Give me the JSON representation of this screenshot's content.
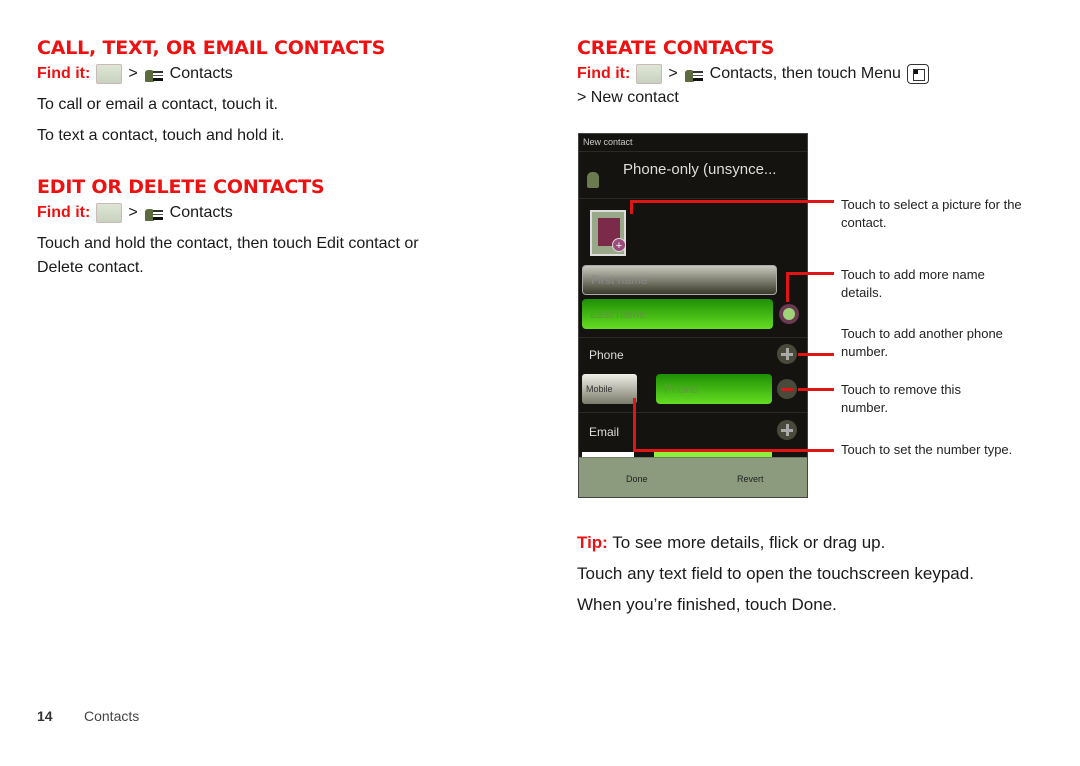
{
  "left": {
    "section1": {
      "heading": "CALL, TEXT, OR EMAIL CONTACTS",
      "findit_label": "Find it:",
      "sep": ">",
      "app_name": "Contacts",
      "lines": [
        "To call or email a contact, touch it.",
        "To text a contact, touch and hold it."
      ]
    },
    "section2": {
      "heading": "EDIT OR DELETE CONTACTS",
      "findit_label": "Find it:",
      "sep": ">",
      "app_name": "Contacts",
      "lines": [
        "Touch and hold the contact, then touch Edit contact or",
        "Delete contact."
      ]
    }
  },
  "right": {
    "heading": "CREATE CONTACTS",
    "findit_label": "Find it:",
    "sep": ">",
    "findit_text": "Contacts, then touch Menu",
    "findit_line2": "> New contact",
    "phone": {
      "title": "New contact",
      "account": "Phone-only (unsynce...",
      "first_name_placeholder": "First name",
      "last_name_placeholder": "Last name",
      "phone_label": "Phone",
      "phone_type": "Mobile",
      "phone_placeholder": "Phone",
      "email_label": "Email",
      "done": "Done",
      "revert": "Revert"
    },
    "callouts": [
      "Touch to select a picture for the contact.",
      "Touch to add more name details.",
      "Touch to add another phone number.",
      "Touch to remove this number.",
      "Touch to set the number type."
    ],
    "tip_label": "Tip:",
    "tip_text": "To see more details, flick or drag up.",
    "para1": "Touch any text field to open the touchscreen keypad.",
    "para2": "When you’re finished, touch Done."
  },
  "footer": {
    "page_number": "14",
    "section": "Contacts"
  },
  "colors": {
    "accent": "#ee1111",
    "field_green": "#66dd22",
    "phone_bg": "#15130f"
  }
}
